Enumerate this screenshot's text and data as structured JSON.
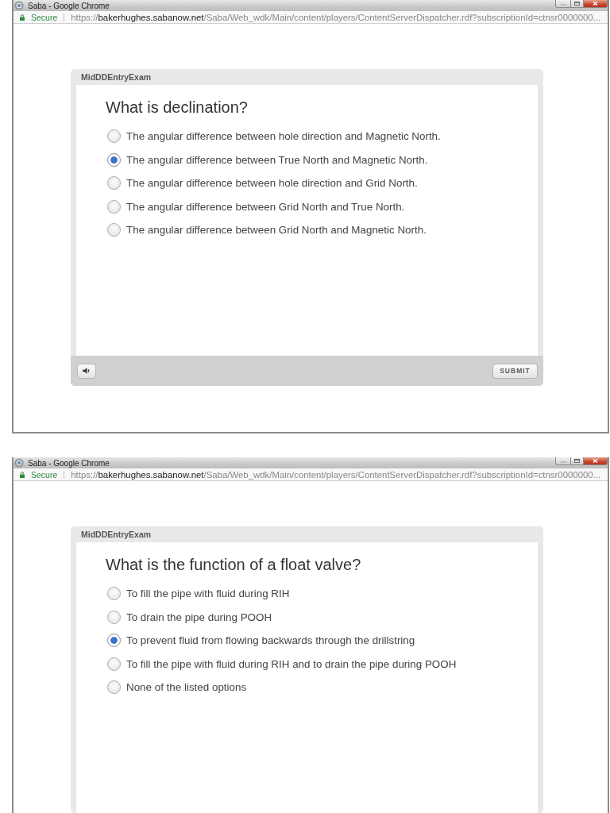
{
  "windows": [
    {
      "title": "Saba - Google Chrome",
      "address_bar": {
        "security": "Secure",
        "url": "https://**bakerhughes.sabanow.net**/Saba/Web_wdk/Main/content/players/ContentServerDispatcher.rdf?subscriptionId=ctnsr0000000..."
      },
      "quiz": {
        "title": "MidDDEntryExam",
        "question": "What is declination?",
        "options": [
          {
            "label": "The angular difference between hole direction and Magnetic North.",
            "selected": false
          },
          {
            "label": "The angular difference between True North and Magnetic North.",
            "selected": true
          },
          {
            "label": "The angular difference between hole direction and Grid North.",
            "selected": false
          },
          {
            "label": "The angular difference between Grid North and True North.",
            "selected": false
          },
          {
            "label": "The angular difference between Grid North and Magnetic North.",
            "selected": false
          }
        ]
      },
      "footer": {
        "submit": "SUBMIT"
      }
    },
    {
      "title": "Saba - Google Chrome",
      "address_bar": {
        "security": "Secure",
        "url": "https://**bakerhughes.sabanow.net**/Saba/Web_wdk/Main/content/players/ContentServerDispatcher.rdf?subscriptionId=ctnsr0000000..."
      },
      "quiz": {
        "title": "MidDDEntryExam",
        "question": "What is the function of a float valve?",
        "options": [
          {
            "label": "To fill the pipe with fluid during RIH",
            "selected": false
          },
          {
            "label": "To drain the pipe during POOH",
            "selected": false
          },
          {
            "label": "To prevent fluid from flowing backwards through the drillstring",
            "selected": true
          },
          {
            "label": "To fill the pipe with fluid during RIH and to drain the pipe during POOH",
            "selected": false
          },
          {
            "label": "None of the listed options",
            "selected": false
          }
        ]
      }
    }
  ]
}
